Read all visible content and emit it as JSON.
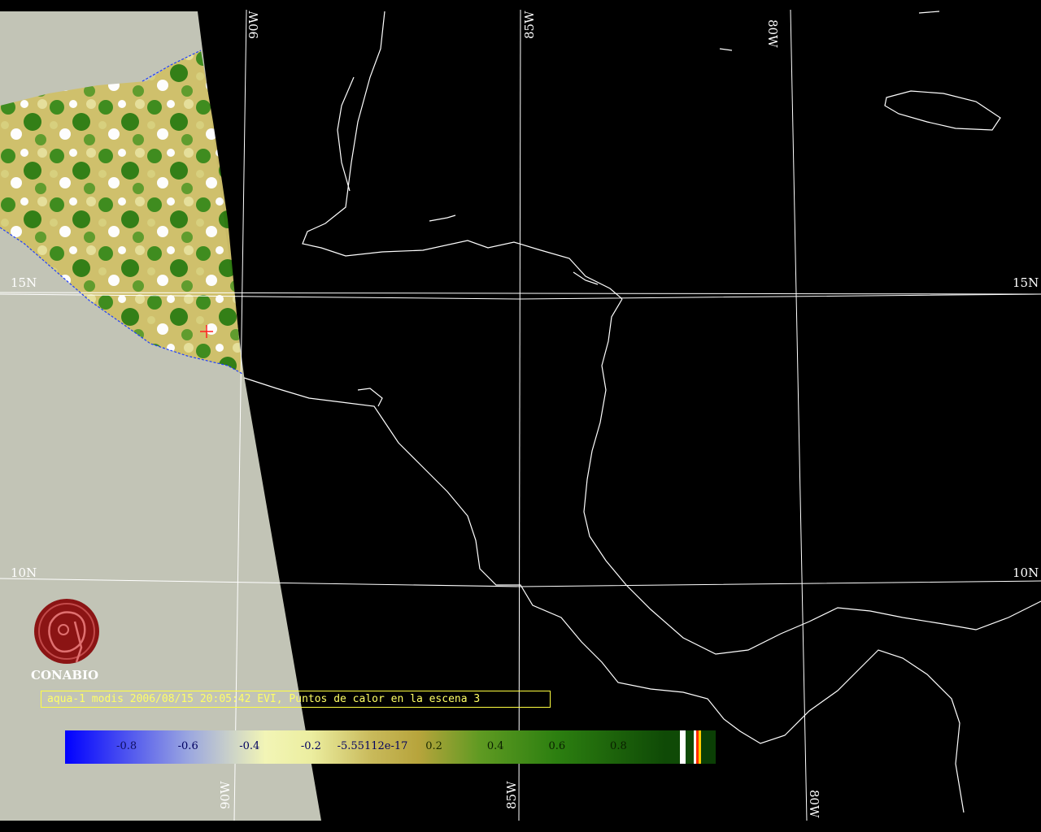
{
  "colors": {
    "background": "#000000",
    "nodata": "#c2c4b6",
    "coastline": "#ffffff",
    "gridline": "#ffffff",
    "caption_text": "#ffff66",
    "caption_border": "#ffff40",
    "logo": "#8b1414"
  },
  "graticule": {
    "lon_labels_top": [
      "90W",
      "85W",
      "80W"
    ],
    "lon_labels_bottom": [
      "90W",
      "85W",
      "80W"
    ],
    "lat_labels_left": [
      "15N",
      "10N"
    ],
    "lat_labels_right": [
      "15N",
      "10N"
    ]
  },
  "logo": {
    "icon": "conabio-seal-icon",
    "text": "CONABIO"
  },
  "caption": {
    "text": "aqua-1 modis 2006/08/15 20:05:42 EVI, Puntos de calor en la escena 3"
  },
  "marker": {
    "icon": "fire-point-cross-icon",
    "color": "#ff2020"
  },
  "colorbar": {
    "ticks": [
      "-0.8",
      "-0.6",
      "-0.4",
      "-0.2",
      "-5.55112e-17",
      "0.2",
      "0.4",
      "0.6",
      "0.8"
    ],
    "range": [
      -1.0,
      1.0
    ],
    "gradient": [
      {
        "v": -1.0,
        "c": "#0000ff"
      },
      {
        "v": -0.6,
        "c": "#9aa6e0"
      },
      {
        "v": -0.35,
        "c": "#f2f5b6"
      },
      {
        "v": -0.2,
        "c": "#eceea0"
      },
      {
        "v": 0.0,
        "c": "#c8b95a"
      },
      {
        "v": 0.15,
        "c": "#b7a43c"
      },
      {
        "v": 0.35,
        "c": "#5f9a22"
      },
      {
        "v": 0.6,
        "c": "#2c7f10"
      },
      {
        "v": 0.95,
        "c": "#0f4a06"
      }
    ]
  }
}
